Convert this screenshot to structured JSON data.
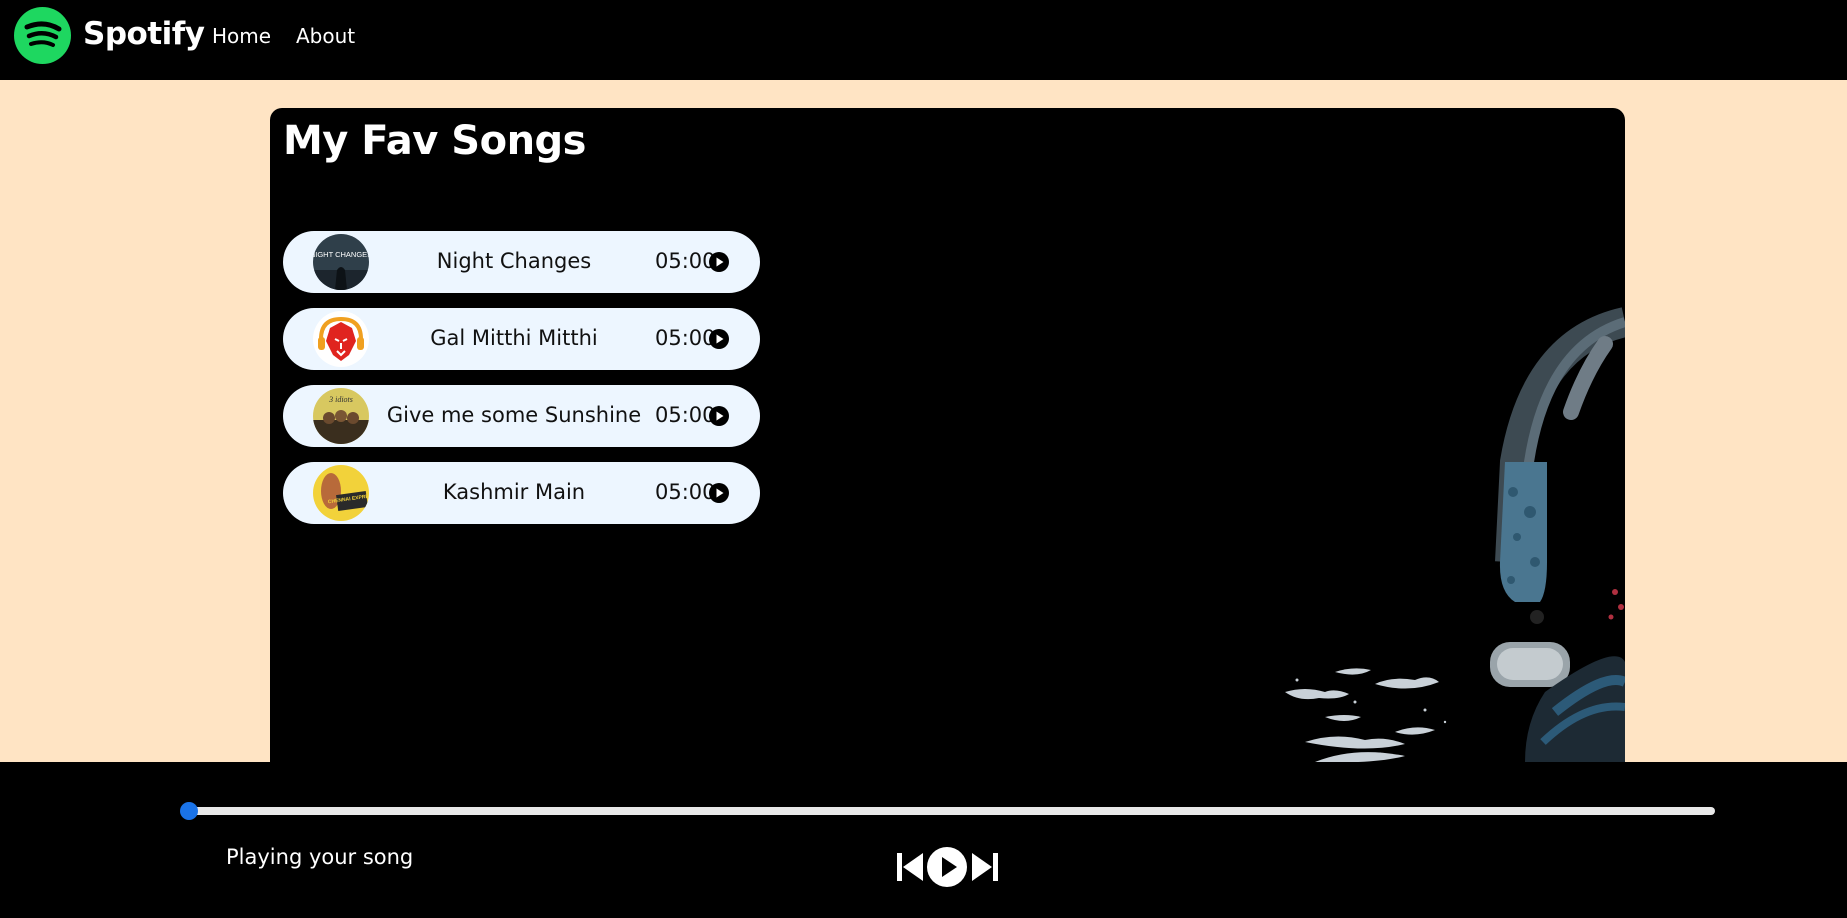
{
  "navbar": {
    "brand": "Spotify",
    "links": [
      {
        "label": "Home"
      },
      {
        "label": "About"
      }
    ]
  },
  "main": {
    "title": "My Fav Songs",
    "songs": [
      {
        "name": "Night Changes",
        "duration": "05:00",
        "cover_text": "NIGHT CHANGES"
      },
      {
        "name": "Gal Mitthi Mitthi",
        "duration": "05:00",
        "cover_text": ""
      },
      {
        "name": "Give me some Sunshine",
        "duration": "05:00",
        "cover_text": "3 idiots"
      },
      {
        "name": "Kashmir Main",
        "duration": "05:00",
        "cover_text": "CHENNAI EXPRESS"
      }
    ]
  },
  "player": {
    "status": "Playing your song",
    "progress": 0,
    "controls": {
      "previous_icon": "skip-previous-icon",
      "play_icon": "play-icon",
      "next_icon": "skip-next-icon"
    }
  },
  "colors": {
    "spotify_green": "#1ed760",
    "page_background": "#ffe4c4",
    "song_item_background": "#edf6ff",
    "progress_thumb": "#1a73e8"
  }
}
